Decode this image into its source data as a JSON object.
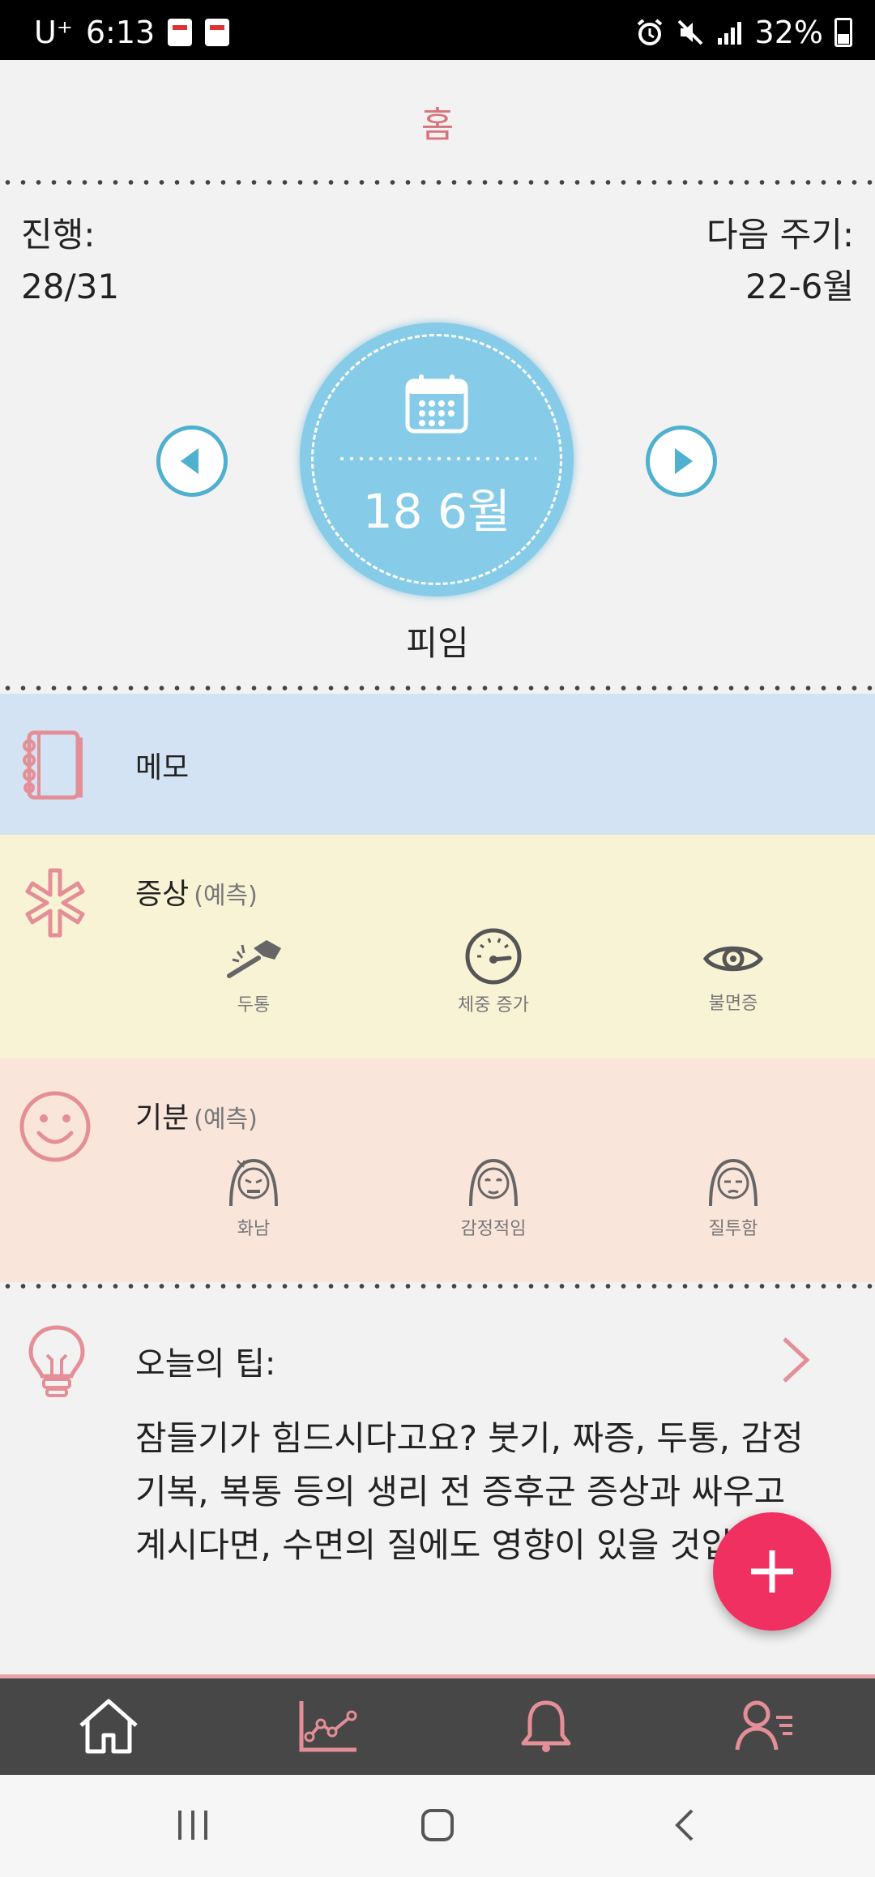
{
  "status": {
    "carrier": "U⁺",
    "time": "6:13",
    "battery": "32%"
  },
  "header": {
    "title": "홈"
  },
  "progress": {
    "label": "진행:",
    "value": "28/31"
  },
  "next_cycle": {
    "label": "다음 주기:",
    "value": "22-6월"
  },
  "date_circle": {
    "date": "18 6월",
    "icon": "calendar-icon"
  },
  "phase": "피임",
  "memo": {
    "label": "메모",
    "icon": "notebook-icon"
  },
  "symptoms": {
    "title": "증상",
    "subtitle": "(예측)",
    "icon": "asterisk-icon",
    "items": [
      {
        "label": "두통",
        "icon": "hammer-headache-icon"
      },
      {
        "label": "체중 증가",
        "icon": "scale-gauge-icon"
      },
      {
        "label": "불면증",
        "icon": "eye-icon"
      }
    ]
  },
  "mood": {
    "title": "기분",
    "subtitle": "(예측)",
    "icon": "smiley-icon",
    "items": [
      {
        "label": "화남",
        "icon": "angry-face-icon"
      },
      {
        "label": "감정적임",
        "icon": "emotional-face-icon"
      },
      {
        "label": "질투함",
        "icon": "jealous-face-icon"
      }
    ]
  },
  "tip": {
    "title": "오늘의 팁:",
    "text": "잠들기가 힘드시다고요? 붓기, 짜증, 두통, 감정 기복, 복통 등의 생리 전 증후군 증상과 싸우고 계시다면, 수면의 질에도 영향이 있을 것입니다.",
    "icon": "lightbulb-icon"
  },
  "tabs": [
    {
      "name": "home",
      "icon": "home-icon"
    },
    {
      "name": "stats",
      "icon": "chart-icon"
    },
    {
      "name": "notifications",
      "icon": "bell-icon"
    },
    {
      "name": "profile",
      "icon": "profile-icon"
    }
  ],
  "colors": {
    "accent": "#d9737b",
    "circle": "#86cbe7",
    "fab": "#f13062",
    "tabbar": "#474747"
  }
}
